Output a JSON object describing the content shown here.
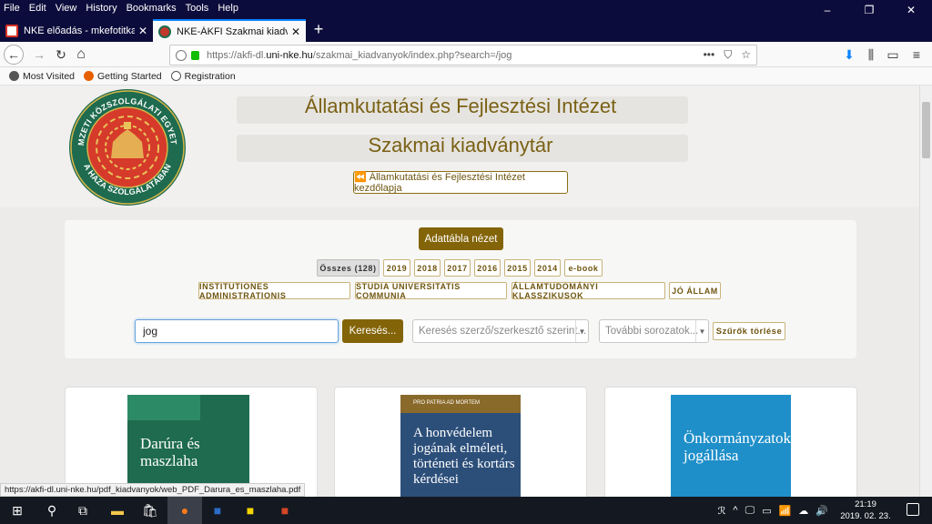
{
  "menu": [
    "File",
    "Edit",
    "View",
    "History",
    "Bookmarks",
    "Tools",
    "Help"
  ],
  "window_controls": [
    "–",
    "❐",
    "✕"
  ],
  "tabs": [
    {
      "title": "NKE előadás - mkefotitkar@gm",
      "close": "✕"
    },
    {
      "title": "NKE-ÁKFI Szakmai kiadványok",
      "close": "✕"
    }
  ],
  "newtab": "+",
  "nav": {
    "back": "←",
    "forward": "→",
    "reload": "↻",
    "home": "⌂"
  },
  "url": {
    "prefix": "https://akfi-dl.",
    "domain": "uni-nke.hu",
    "path": "/szakmai_kiadvanyok/index.php?search=/jog"
  },
  "url_actions": [
    "•••",
    "⛉",
    "☆"
  ],
  "toolbar_right": [
    "⬇",
    "⫼",
    "▭",
    "≡"
  ],
  "bookmarks": [
    {
      "label": "Most Visited",
      "icon": "gear-icon",
      "color": "#555555"
    },
    {
      "label": "Getting Started",
      "icon": "firefox-icon",
      "color": "#e66000"
    },
    {
      "label": "Registration",
      "icon": "globe-icon",
      "color": "#555555"
    }
  ],
  "header": {
    "title": "Államkutatási és Fejlesztési Intézet",
    "subtitle": "Szakmai kiadványtár",
    "home_link": "⏪ Államkutatási és Fejlesztési Intézet kezdőlapja",
    "logo_ring_top": "NEMZETI KÖZSZOLGÁLATI EGYETEM",
    "logo_ring_bottom": "A HAZA SZOLGÁLATÁBAN"
  },
  "filters": {
    "datatable_button": "Adattábla nézet",
    "years": [
      "Összes (128)",
      "2019",
      "2018",
      "2017",
      "2016",
      "2015",
      "2014",
      "e-book"
    ],
    "series": [
      "INSTITUTIONES ADMINISTRATIONIS",
      "STUDIA UNIVERSITATIS COMMUNIA",
      "ÁLLAMTUDOMÁNYI KLASSZIKUSOK",
      "JÓ ÁLLAM"
    ],
    "search_value": "jog",
    "search_button": "Keresés...",
    "author_placeholder": "Keresés szerző/szerkesztő szerint...",
    "series_placeholder": "További sorozatok...",
    "clear_button": "Szűrők törlése"
  },
  "books": [
    {
      "title": "Darúra és maszlaha",
      "cover_color": "#1e6b4f"
    },
    {
      "title": "A honvédelem jogának elméleti, történeti és kortárs kérdései",
      "header": "PRO PATRIA AD MORTEM",
      "cover_color": "#2c4f7a"
    },
    {
      "title": "Önkormányzatok jogállása",
      "cover_color": "#1f8fc9"
    }
  ],
  "status_url": "https://akfi-dl.uni-nke.hu/pdf_kiadvanyok/web_PDF_Darura_es_maszlaha.pdf",
  "taskbar": {
    "tray": [
      "ℛ",
      "^",
      "🖵",
      "▭",
      "📶",
      "☁",
      "🔊"
    ],
    "time": "21:19",
    "date": "2019. 02. 23."
  },
  "colors": {
    "accent": "#836408",
    "menubar": "#0c0c3c"
  }
}
